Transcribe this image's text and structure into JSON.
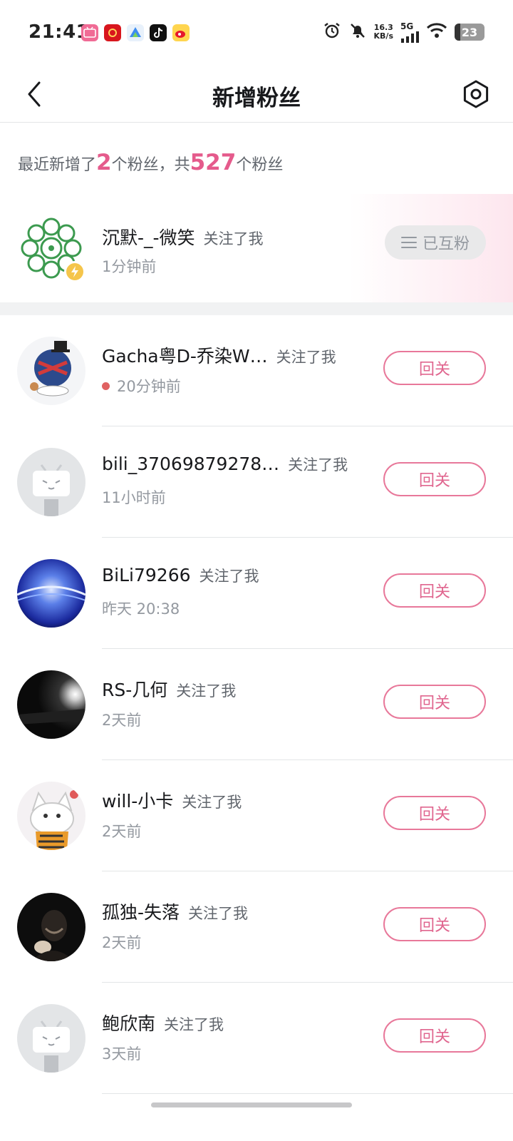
{
  "status_bar": {
    "time": "21:41",
    "net_speed_value": "16.3",
    "net_speed_unit": "KB/s",
    "network_type": "5G",
    "battery": "23",
    "app_icons": [
      "bilibili-icon",
      "red-app-icon",
      "maps-icon",
      "tiktok-icon",
      "weibo-icon"
    ]
  },
  "header": {
    "title": "新增粉丝",
    "back_icon": "chevron-left-icon",
    "settings_icon": "settings-icon"
  },
  "summary": {
    "prefix": "最近新增了",
    "new_count": "2",
    "middle": "个粉丝，共",
    "total_count": "527",
    "suffix": "个粉丝"
  },
  "colors": {
    "accent_pink": "#e55b8c",
    "button_border": "#e8789a",
    "divider": "#e3e5e7"
  },
  "followers": [
    {
      "name": "沉默-_-微笑",
      "action": "关注了我",
      "time": "1分钟前",
      "button": "已互粉",
      "mutual": true,
      "avatar": "mandala-avatar"
    },
    {
      "name": "Gacha粤D-乔染W…",
      "action": "关注了我",
      "time": "20分钟前",
      "button": "回关",
      "online": true,
      "avatar": "cartoon-avatar"
    },
    {
      "name": "bili_37069879278…",
      "action": "关注了我",
      "time": "11小时前",
      "button": "回关",
      "avatar": "default-tv-avatar"
    },
    {
      "name": "BiLi79266",
      "action": "关注了我",
      "time": "昨天 20:38",
      "button": "回关",
      "avatar": "blue-abstract-avatar"
    },
    {
      "name": "RS-几何",
      "action": "关注了我",
      "time": "2天前",
      "button": "回关",
      "avatar": "dark-photo-avatar"
    },
    {
      "name": "will-小卡",
      "action": "关注了我",
      "time": "2天前",
      "button": "回关",
      "avatar": "cat-avatar"
    },
    {
      "name": "孤独-失落",
      "action": "关注了我",
      "time": "2天前",
      "button": "回关",
      "avatar": "dark-person-avatar"
    },
    {
      "name": "鲍欣南",
      "action": "关注了我",
      "time": "3天前",
      "button": "回关",
      "avatar": "default-tv-avatar"
    }
  ]
}
